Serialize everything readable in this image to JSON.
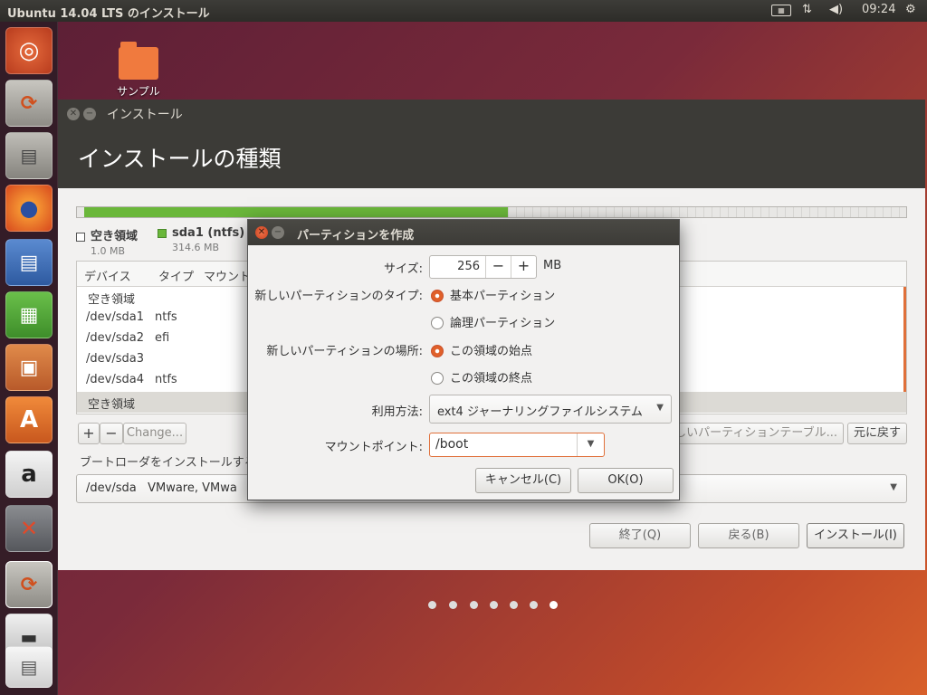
{
  "topbar": {
    "title": "Ubuntu 14.04 LTS のインストール",
    "time": "09:24"
  },
  "desktop": {
    "icon_label": "サンプル"
  },
  "launcher": {
    "items": [
      "ubuntu-dash-icon",
      "installer-icon",
      "file-manager-icon",
      "firefox-icon",
      "writer-icon",
      "calc-icon",
      "impress-icon",
      "software-center-icon",
      "amazon-icon",
      "system-settings-icon",
      "installer-active-icon",
      "floppy-icon",
      "trash-icon"
    ]
  },
  "installer": {
    "window_title": "インストール",
    "heading": "インストールの種類",
    "legend": [
      {
        "name": "空き領域",
        "size": "1.0 MB",
        "color": "#ffffff"
      },
      {
        "name": "sda1 (ntfs)",
        "size": "314.6 MB",
        "color": "#6ab73a"
      }
    ],
    "table": {
      "headers": [
        "デバイス",
        "タイプ",
        "マウント"
      ],
      "rows": [
        {
          "device": "空き領域",
          "type": ""
        },
        {
          "device": "/dev/sda1",
          "type": "ntfs"
        },
        {
          "device": "/dev/sda2",
          "type": "efi"
        },
        {
          "device": "/dev/sda3",
          "type": ""
        },
        {
          "device": "/dev/sda4",
          "type": "ntfs"
        },
        {
          "device": "空き領域",
          "type": ""
        }
      ]
    },
    "add_label": "+",
    "remove_label": "−",
    "change_label": "Change...",
    "new_table_label": "しいパーティションテーブル...",
    "revert_label": "元に戻す",
    "bootloader_label": "ブートローダをインストールするデ",
    "bootloader_value": "/dev/sda   VMware, VMwa",
    "quit_label": "終了(Q)",
    "back_label": "戻る(B)",
    "install_label": "インストール(I)"
  },
  "dialog": {
    "title": "パーティションを作成",
    "size_label": "サイズ:",
    "size_value": "256",
    "size_unit": "MB",
    "type_label": "新しいパーティションのタイプ:",
    "type_primary": "基本パーティション",
    "type_logical": "論理パーティション",
    "location_label": "新しいパーティションの場所:",
    "location_start": "この領域の始点",
    "location_end": "この領域の終点",
    "use_label": "利用方法:",
    "use_value": "ext4 ジャーナリングファイルシステム",
    "mount_label": "マウントポイント:",
    "mount_value": "/boot",
    "cancel_label": "キャンセル(C)",
    "ok_label": "OK(O)"
  },
  "progress": {
    "total_steps": 7,
    "current_step": 7
  },
  "colors": {
    "accent": "#e0602a",
    "used": "#6ab73a",
    "header": "#3c3b37"
  }
}
